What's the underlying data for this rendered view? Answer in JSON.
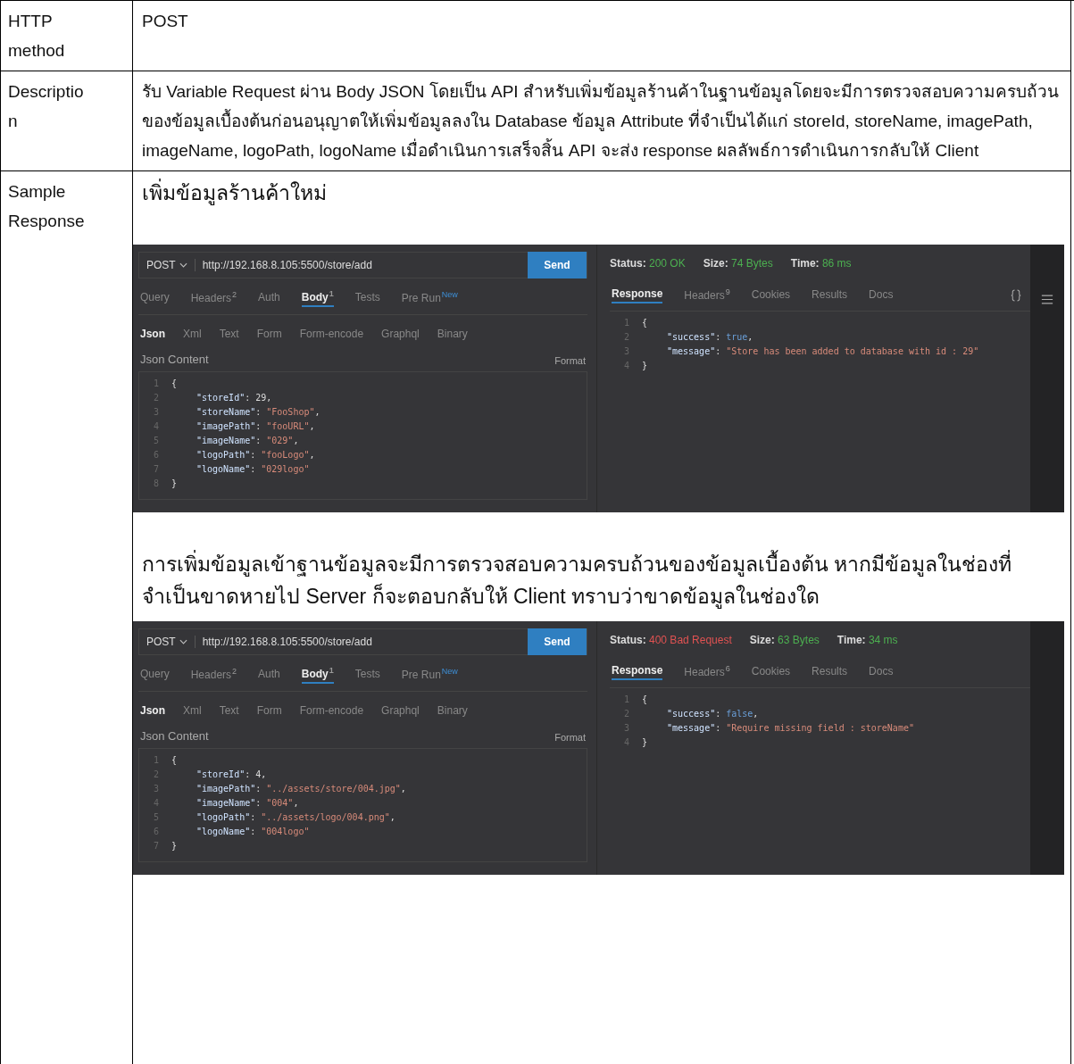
{
  "rows": [
    {
      "kind": "text",
      "label_lines": [
        "HTTP",
        "method"
      ],
      "value": "POST"
    },
    {
      "kind": "text",
      "label_lines": [
        "Descriptio",
        "n"
      ],
      "value": "รับ Variable Request ผ่าน Body JSON โดยเป็น API สำหรับเพิ่มข้อมูลร้านค้าในฐานข้อมูลโดยจะมีการตรวจสอบความครบถ้วนของข้อมูลเบื้องต้นก่อนอนุญาตให้เพิ่มข้อมูลลงใน Database ข้อมูล Attribute ที่จำเป็นได้แก่ storeId, storeName, imagePath, imageName, logoPath, logoName เมื่อดำเนินการเสร็จสิ้น API จะส่ง response ผลลัพธ์การดำเนินการกลับให้ Client"
    },
    {
      "kind": "samples",
      "label_lines": [
        "Sample",
        "Response"
      ],
      "blocks": [
        {
          "kind": "text",
          "text": "เพิ่มข้อมูลร้านค้าใหม่"
        },
        {
          "kind": "screenshot",
          "method": "POST",
          "url": "http://192.168.8.105:5500/store/add",
          "send": "Send",
          "tool_icons": true,
          "request_tabs": [
            {
              "label": "Query",
              "selected": false
            },
            {
              "label": "Headers",
              "selected": false,
              "badge": {
                "text": "2",
                "kind": "count"
              }
            },
            {
              "label": "Auth",
              "selected": false
            },
            {
              "label": "Body",
              "selected": true,
              "badge": {
                "text": "1",
                "kind": "count"
              }
            },
            {
              "label": "Tests",
              "selected": false
            },
            {
              "label": "Pre Run",
              "selected": false,
              "badge": {
                "text": "New",
                "kind": "new"
              }
            }
          ],
          "body_tabs": [
            {
              "label": "Json",
              "selected": true
            },
            {
              "label": "Xml",
              "selected": false
            },
            {
              "label": "Text",
              "selected": false
            },
            {
              "label": "Form",
              "selected": false
            },
            {
              "label": "Form-encode",
              "selected": false
            },
            {
              "label": "Graphql",
              "selected": false
            },
            {
              "label": "Binary",
              "selected": false
            }
          ],
          "content_label": "Json Content",
          "format": "Format",
          "request_lines": [
            {
              "number": "1",
              "kind": "brace",
              "parts": [
                {
                  "kind": "punct",
                  "text": "{"
                }
              ]
            },
            {
              "number": "2",
              "kind": "pair",
              "parts": [
                {
                  "kind": "key",
                  "text": "\"storeId\""
                },
                {
                  "kind": "punct",
                  "text": ": "
                },
                {
                  "kind": "number",
                  "text": "29"
                },
                {
                  "kind": "punct",
                  "text": ","
                }
              ]
            },
            {
              "number": "3",
              "kind": "pair",
              "parts": [
                {
                  "kind": "key",
                  "text": "\"storeName\""
                },
                {
                  "kind": "punct",
                  "text": ": "
                },
                {
                  "kind": "string",
                  "text": "\"FooShop\""
                },
                {
                  "kind": "punct",
                  "text": ","
                }
              ]
            },
            {
              "number": "4",
              "kind": "pair",
              "parts": [
                {
                  "kind": "key",
                  "text": "\"imagePath\""
                },
                {
                  "kind": "punct",
                  "text": ": "
                },
                {
                  "kind": "string",
                  "text": "\"fooURL\""
                },
                {
                  "kind": "punct",
                  "text": ","
                }
              ]
            },
            {
              "number": "5",
              "kind": "pair",
              "parts": [
                {
                  "kind": "key",
                  "text": "\"imageName\""
                },
                {
                  "kind": "punct",
                  "text": ": "
                },
                {
                  "kind": "string",
                  "text": "\"029\""
                },
                {
                  "kind": "punct",
                  "text": ","
                }
              ]
            },
            {
              "number": "6",
              "kind": "pair",
              "parts": [
                {
                  "kind": "key",
                  "text": "\"logoPath\""
                },
                {
                  "kind": "punct",
                  "text": ": "
                },
                {
                  "kind": "string",
                  "text": "\"fooLogo\""
                },
                {
                  "kind": "punct",
                  "text": ","
                }
              ]
            },
            {
              "number": "7",
              "kind": "pair",
              "parts": [
                {
                  "kind": "key",
                  "text": "\"logoName\""
                },
                {
                  "kind": "punct",
                  "text": ": "
                },
                {
                  "kind": "string",
                  "text": "\"029logo\""
                }
              ]
            },
            {
              "number": "8",
              "kind": "brace",
              "parts": [
                {
                  "kind": "punct",
                  "text": "}"
                }
              ]
            }
          ],
          "status": [
            {
              "label": "Status:",
              "value": "200 OK",
              "color": "#4caf50"
            },
            {
              "label": "Size:",
              "value": "74 Bytes",
              "color": "#4caf50"
            },
            {
              "label": "Time:",
              "value": "86 ms",
              "color": "#4caf50"
            }
          ],
          "response_tabs": [
            {
              "label": "Response",
              "selected": true
            },
            {
              "label": "Headers",
              "selected": false,
              "badge": {
                "text": "9",
                "kind": "count"
              }
            },
            {
              "label": "Cookies",
              "selected": false
            },
            {
              "label": "Results",
              "selected": false
            },
            {
              "label": "Docs",
              "selected": false
            }
          ],
          "response_lines": [
            {
              "number": "1",
              "kind": "brace",
              "parts": [
                {
                  "kind": "punct",
                  "text": "{"
                }
              ]
            },
            {
              "number": "2",
              "kind": "pair",
              "parts": [
                {
                  "kind": "key",
                  "text": "\"success\""
                },
                {
                  "kind": "punct",
                  "text": ": "
                },
                {
                  "kind": "boolean",
                  "text": "true"
                },
                {
                  "kind": "punct",
                  "text": ","
                }
              ]
            },
            {
              "number": "3",
              "kind": "pair",
              "parts": [
                {
                  "kind": "key",
                  "text": "\"message\""
                },
                {
                  "kind": "punct",
                  "text": ": "
                },
                {
                  "kind": "string",
                  "text": "\"Store has been added to database with id : 29\""
                }
              ]
            },
            {
              "number": "4",
              "kind": "brace",
              "parts": [
                {
                  "kind": "punct",
                  "text": "}"
                }
              ]
            }
          ]
        },
        {
          "kind": "text",
          "text": "การเพิ่มข้อมูลเข้าฐานข้อมูลจะมีการตรวจสอบความครบถ้วนของข้อมูลเบื้องต้น หากมีข้อมูลในช่องที่จำเป็นขาดหายไป Server ก็จะตอบกลับให้ Client ทราบว่าขาดข้อมูลในช่องใด"
        },
        {
          "kind": "screenshot",
          "method": "POST",
          "url": "http://192.168.8.105:5500/store/add",
          "send": "Send",
          "tool_icons": false,
          "request_tabs": [
            {
              "label": "Query",
              "selected": false
            },
            {
              "label": "Headers",
              "selected": false,
              "badge": {
                "text": "2",
                "kind": "count"
              }
            },
            {
              "label": "Auth",
              "selected": false
            },
            {
              "label": "Body",
              "selected": true,
              "badge": {
                "text": "1",
                "kind": "count"
              }
            },
            {
              "label": "Tests",
              "selected": false
            },
            {
              "label": "Pre Run",
              "selected": false,
              "badge": {
                "text": "New",
                "kind": "new"
              }
            }
          ],
          "body_tabs": [
            {
              "label": "Json",
              "selected": true
            },
            {
              "label": "Xml",
              "selected": false
            },
            {
              "label": "Text",
              "selected": false
            },
            {
              "label": "Form",
              "selected": false
            },
            {
              "label": "Form-encode",
              "selected": false
            },
            {
              "label": "Graphql",
              "selected": false
            },
            {
              "label": "Binary",
              "selected": false
            }
          ],
          "content_label": "Json Content",
          "format": "Format",
          "request_lines": [
            {
              "number": "1",
              "kind": "brace",
              "parts": [
                {
                  "kind": "punct",
                  "text": "{"
                }
              ]
            },
            {
              "number": "2",
              "kind": "pair",
              "parts": [
                {
                  "kind": "key",
                  "text": "\"storeId\""
                },
                {
                  "kind": "punct",
                  "text": ": "
                },
                {
                  "kind": "number",
                  "text": "4"
                },
                {
                  "kind": "punct",
                  "text": ","
                }
              ]
            },
            {
              "number": "3",
              "kind": "pair",
              "parts": [
                {
                  "kind": "key",
                  "text": "\"imagePath\""
                },
                {
                  "kind": "punct",
                  "text": ": "
                },
                {
                  "kind": "string",
                  "text": "\"../assets/store/004.jpg\""
                },
                {
                  "kind": "punct",
                  "text": ","
                }
              ]
            },
            {
              "number": "4",
              "kind": "pair",
              "parts": [
                {
                  "kind": "key",
                  "text": "\"imageName\""
                },
                {
                  "kind": "punct",
                  "text": ": "
                },
                {
                  "kind": "string",
                  "text": "\"004\""
                },
                {
                  "kind": "punct",
                  "text": ","
                }
              ]
            },
            {
              "number": "5",
              "kind": "pair",
              "parts": [
                {
                  "kind": "key",
                  "text": "\"logoPath\""
                },
                {
                  "kind": "punct",
                  "text": ": "
                },
                {
                  "kind": "string",
                  "text": "\"../assets/logo/004.png\""
                },
                {
                  "kind": "punct",
                  "text": ","
                }
              ]
            },
            {
              "number": "6",
              "kind": "pair",
              "parts": [
                {
                  "kind": "key",
                  "text": "\"logoName\""
                },
                {
                  "kind": "punct",
                  "text": ": "
                },
                {
                  "kind": "string",
                  "text": "\"004logo\""
                }
              ]
            },
            {
              "number": "7",
              "kind": "brace",
              "parts": [
                {
                  "kind": "punct",
                  "text": "}"
                }
              ]
            }
          ],
          "status": [
            {
              "label": "Status:",
              "value": "400 Bad Request",
              "color": "#e05252"
            },
            {
              "label": "Size:",
              "value": "63 Bytes",
              "color": "#4caf50"
            },
            {
              "label": "Time:",
              "value": "34 ms",
              "color": "#4caf50"
            }
          ],
          "response_tabs": [
            {
              "label": "Response",
              "selected": true
            },
            {
              "label": "Headers",
              "selected": false,
              "badge": {
                "text": "6",
                "kind": "count"
              }
            },
            {
              "label": "Cookies",
              "selected": false
            },
            {
              "label": "Results",
              "selected": false
            },
            {
              "label": "Docs",
              "selected": false
            }
          ],
          "response_lines": [
            {
              "number": "1",
              "kind": "brace",
              "parts": [
                {
                  "kind": "punct",
                  "text": "{"
                }
              ]
            },
            {
              "number": "2",
              "kind": "pair",
              "parts": [
                {
                  "kind": "key",
                  "text": "\"success\""
                },
                {
                  "kind": "punct",
                  "text": ": "
                },
                {
                  "kind": "boolean",
                  "text": "false"
                },
                {
                  "kind": "punct",
                  "text": ","
                }
              ]
            },
            {
              "number": "3",
              "kind": "pair",
              "parts": [
                {
                  "kind": "key",
                  "text": "\"message\""
                },
                {
                  "kind": "punct",
                  "text": ": "
                },
                {
                  "kind": "string",
                  "text": "\"Require missing field : storeName\""
                }
              ]
            },
            {
              "number": "4",
              "kind": "brace",
              "parts": [
                {
                  "kind": "punct",
                  "text": "}"
                }
              ]
            }
          ]
        }
      ]
    }
  ]
}
